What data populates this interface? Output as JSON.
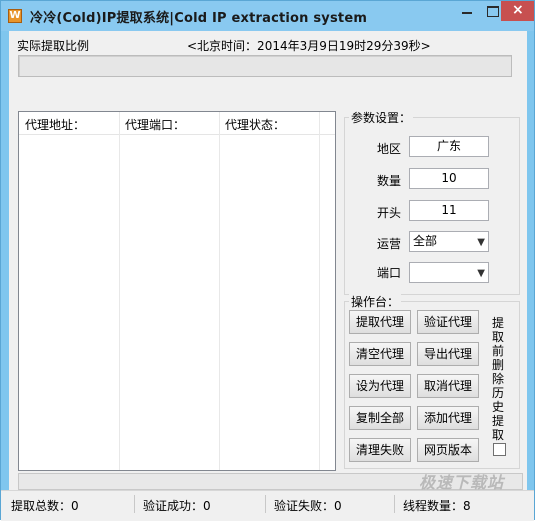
{
  "window": {
    "title": "冷冷(Cold)IP提取系统|Cold IP extraction system",
    "icon": "app-icon",
    "controls": {
      "minimize": "minimize-icon",
      "maximize": "maximize-icon",
      "close": "×"
    }
  },
  "top": {
    "ratio_label": "实际提取比例",
    "beijing_time": "<北京时间：2014年3月9日19时29分39秒>"
  },
  "list": {
    "columns": [
      "代理地址：",
      "代理端口：",
      "代理状态："
    ],
    "rows": []
  },
  "params": {
    "group_label": "参数设置：",
    "region_label": "地区",
    "region_value": "广东",
    "count_label": "数量",
    "count_value": "10",
    "prefix_label": "开头",
    "prefix_value": "11",
    "carrier_label": "运营",
    "carrier_value": "全部",
    "port_label": "端口",
    "port_value": ""
  },
  "ops": {
    "group_label": "操作台：",
    "buttons": [
      "提取代理",
      "验证代理",
      "清空代理",
      "导出代理",
      "设为代理",
      "取消代理",
      "复制全部",
      "添加代理",
      "清理失败",
      "网页版本"
    ],
    "vertical_label": "提取前删除历史提取·",
    "checkbox_checked": false
  },
  "status": {
    "total": "提取总数：0",
    "verify_ok": "验证成功：0",
    "verify_fail": "验证失败：0",
    "threads": "线程数量：8"
  },
  "watermark": "极速下载站",
  "colors": {
    "titlebar": "#89c9f0",
    "close": "#c75050"
  }
}
